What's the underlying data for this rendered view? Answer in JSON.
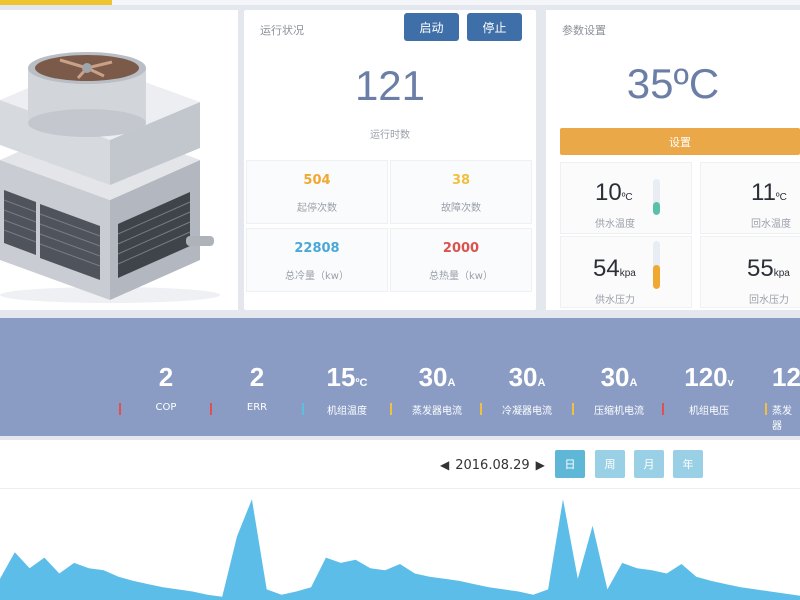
{
  "run_status": {
    "title": "运行状况",
    "start_button": "启动",
    "stop_button": "停止",
    "run_hours_value": "121",
    "run_hours_label": "运行时数",
    "stats": [
      {
        "value": "504",
        "label": "起停次数",
        "color": "#f0a830"
      },
      {
        "value": "38",
        "label": "故障次数",
        "color": "#f0c040"
      },
      {
        "value": "22808",
        "label": "总冷量（kw）",
        "color": "#4aa8d8"
      },
      {
        "value": "2000",
        "label": "总热量（kw）",
        "color": "#d9534f"
      }
    ]
  },
  "params": {
    "title": "参数设置",
    "setpoint_value": "35ºC",
    "set_button": "设置",
    "cells": [
      {
        "value": "10",
        "unit": "ºC",
        "label": "供水温度",
        "gauge_level": 0.35,
        "gauge_color": "#5bc0a8"
      },
      {
        "value": "11",
        "unit": "ºC",
        "label": "回水温度"
      },
      {
        "value": "54",
        "unit": "kpa",
        "label": "供水压力",
        "gauge_level": 0.5,
        "gauge_color": "#f0a830"
      },
      {
        "value": "55",
        "unit": "kpa",
        "label": "回水压力"
      }
    ]
  },
  "metrics": [
    {
      "value": "2",
      "unit": "",
      "label": "COP",
      "bar_color": "#e05050"
    },
    {
      "value": "2",
      "unit": "",
      "label": "ERR",
      "bar_color": "#e05050"
    },
    {
      "value": "15",
      "unit": "ºC",
      "label": "机组温度",
      "bar_color": "#5bc0de"
    },
    {
      "value": "30",
      "unit": "A",
      "label": "蒸发器电流",
      "bar_color": "#f0c040"
    },
    {
      "value": "30",
      "unit": "A",
      "label": "冷凝器电流",
      "bar_color": "#f0c040"
    },
    {
      "value": "30",
      "unit": "A",
      "label": "压缩机电流",
      "bar_color": "#f0c040"
    },
    {
      "value": "120",
      "unit": "v",
      "label": "机组电压",
      "bar_color": "#e05050"
    },
    {
      "value": "12",
      "unit": "",
      "label": "蒸发器",
      "bar_color": "#f0c040"
    }
  ],
  "chart_nav": {
    "date": "2016.08.29",
    "periods": [
      "日",
      "周",
      "月",
      "年"
    ],
    "active_period": "日"
  },
  "chart_data": {
    "type": "area",
    "title": "",
    "xlabel": "",
    "ylabel": "",
    "color": "#5bbde8",
    "ylim": [
      0,
      100
    ],
    "values": [
      20,
      45,
      30,
      40,
      25,
      35,
      30,
      28,
      22,
      18,
      15,
      12,
      10,
      8,
      5,
      3,
      60,
      95,
      10,
      5,
      8,
      12,
      40,
      35,
      38,
      30,
      28,
      34,
      25,
      22,
      20,
      18,
      15,
      12,
      10,
      8,
      5,
      10,
      95,
      20,
      70,
      10,
      35,
      30,
      28,
      25,
      34,
      22,
      18,
      15,
      12,
      10,
      8,
      6,
      4
    ]
  }
}
